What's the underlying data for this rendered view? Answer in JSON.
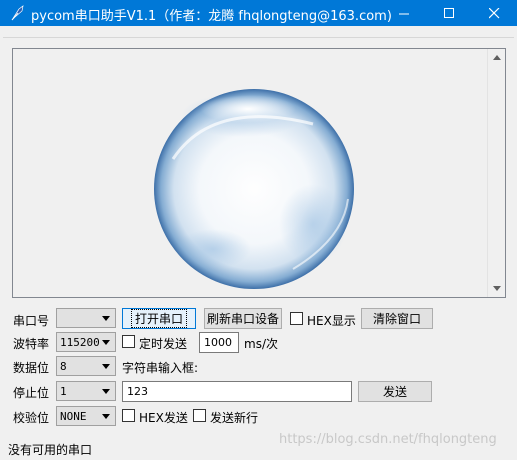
{
  "window": {
    "title": "pycom串口助手V1.1（作者：龙腾 fhqlongteng@163.com)",
    "app_icon": "feather-pen-icon",
    "controls": [
      "minimize-icon",
      "maximize-icon",
      "close-icon"
    ],
    "title_bar_color": "#0078d7"
  },
  "display_area": {
    "image": "glass-sphere-bubble",
    "scrollbar_up": "▲",
    "scrollbar_down": "▼"
  },
  "row1": {
    "port_label": "串口号",
    "port_value": "",
    "open_button": "打开串口",
    "refresh_button": "刷新串口设备",
    "hex_display_label": "HEX显示",
    "hex_display_checked": false,
    "clear_button": "清除窗口"
  },
  "row2": {
    "baud_label": "波特率",
    "baud_value": "115200",
    "timer_send_label": "定时发送",
    "timer_send_checked": false,
    "interval_value": "1000",
    "interval_unit": "ms/次"
  },
  "row3": {
    "databits_label": "数据位",
    "databits_value": "8",
    "input_label": "字符串输入框:"
  },
  "row4": {
    "stopbits_label": "停止位",
    "stopbits_value": "1",
    "input_value": "123",
    "send_button": "发送"
  },
  "row5": {
    "parity_label": "校验位",
    "parity_value": "NONE",
    "hex_send_label": "HEX发送",
    "hex_send_checked": false,
    "newline_label": "发送新行",
    "newline_checked": false
  },
  "status": {
    "text": "没有可用的串口"
  },
  "watermark": "https://blog.csdn.net/fhqlongteng"
}
